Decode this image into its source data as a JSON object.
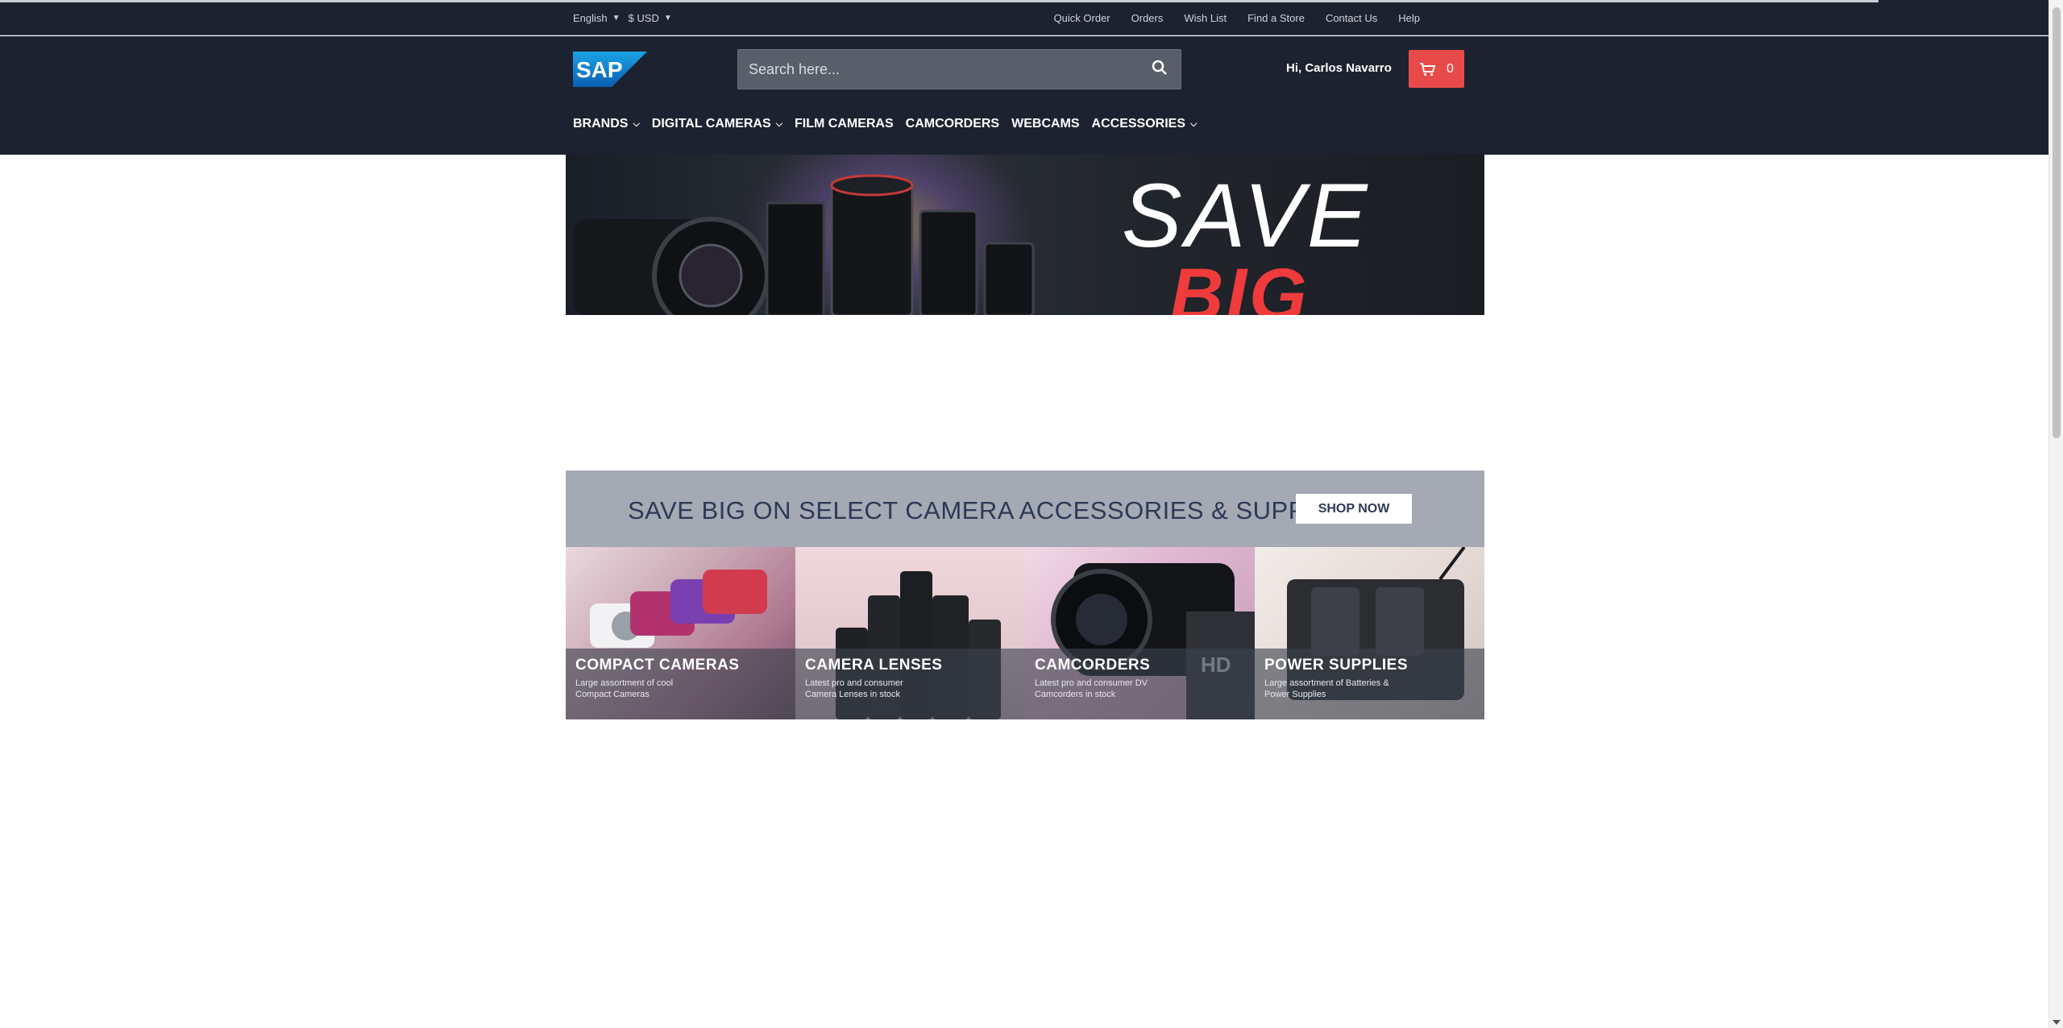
{
  "topbar": {
    "language": "English",
    "currency": "$ USD",
    "links": [
      "Quick Order",
      "Orders",
      "Wish List",
      "Find a Store",
      "Contact Us",
      "Help"
    ]
  },
  "header": {
    "logo_text": "SAP",
    "search_placeholder": "Search here...",
    "greeting": "Hi, Carlos Navarro",
    "cart_count": "0",
    "nav": [
      {
        "label": "BRANDS",
        "dropdown": true
      },
      {
        "label": "DIGITAL CAMERAS",
        "dropdown": true
      },
      {
        "label": "FILM CAMERAS",
        "dropdown": false
      },
      {
        "label": "CAMCORDERS",
        "dropdown": false
      },
      {
        "label": "WEBCAMS",
        "dropdown": false
      },
      {
        "label": "ACCESSORIES",
        "dropdown": true
      }
    ]
  },
  "hero": {
    "line1": "SAVE",
    "line2": "BIG"
  },
  "promo": {
    "text": "SAVE BIG ON SELECT CAMERA ACCESSORIES & SUPPLIES",
    "button": "SHOP NOW"
  },
  "tiles": [
    {
      "title": "COMPACT CAMERAS",
      "desc": "Large assortment of cool Compact Cameras"
    },
    {
      "title": "CAMERA LENSES",
      "desc": "Latest pro and consumer Camera Lenses in stock"
    },
    {
      "title": "CAMCORDERS",
      "desc": "Latest pro and consumer DV Camcorders in stock"
    },
    {
      "title": "POWER SUPPLIES",
      "desc": "Large assortment of Batteries & Power Supplies"
    }
  ],
  "colors": {
    "header_bg": "#1d2230",
    "cart_bg": "#e84a4a",
    "accent_red": "#ef3b3b",
    "promo_bg": "#a4a9b4"
  },
  "icons": {
    "search": "search-icon",
    "cart": "cart-icon",
    "chevron": "chevron-down-icon"
  }
}
